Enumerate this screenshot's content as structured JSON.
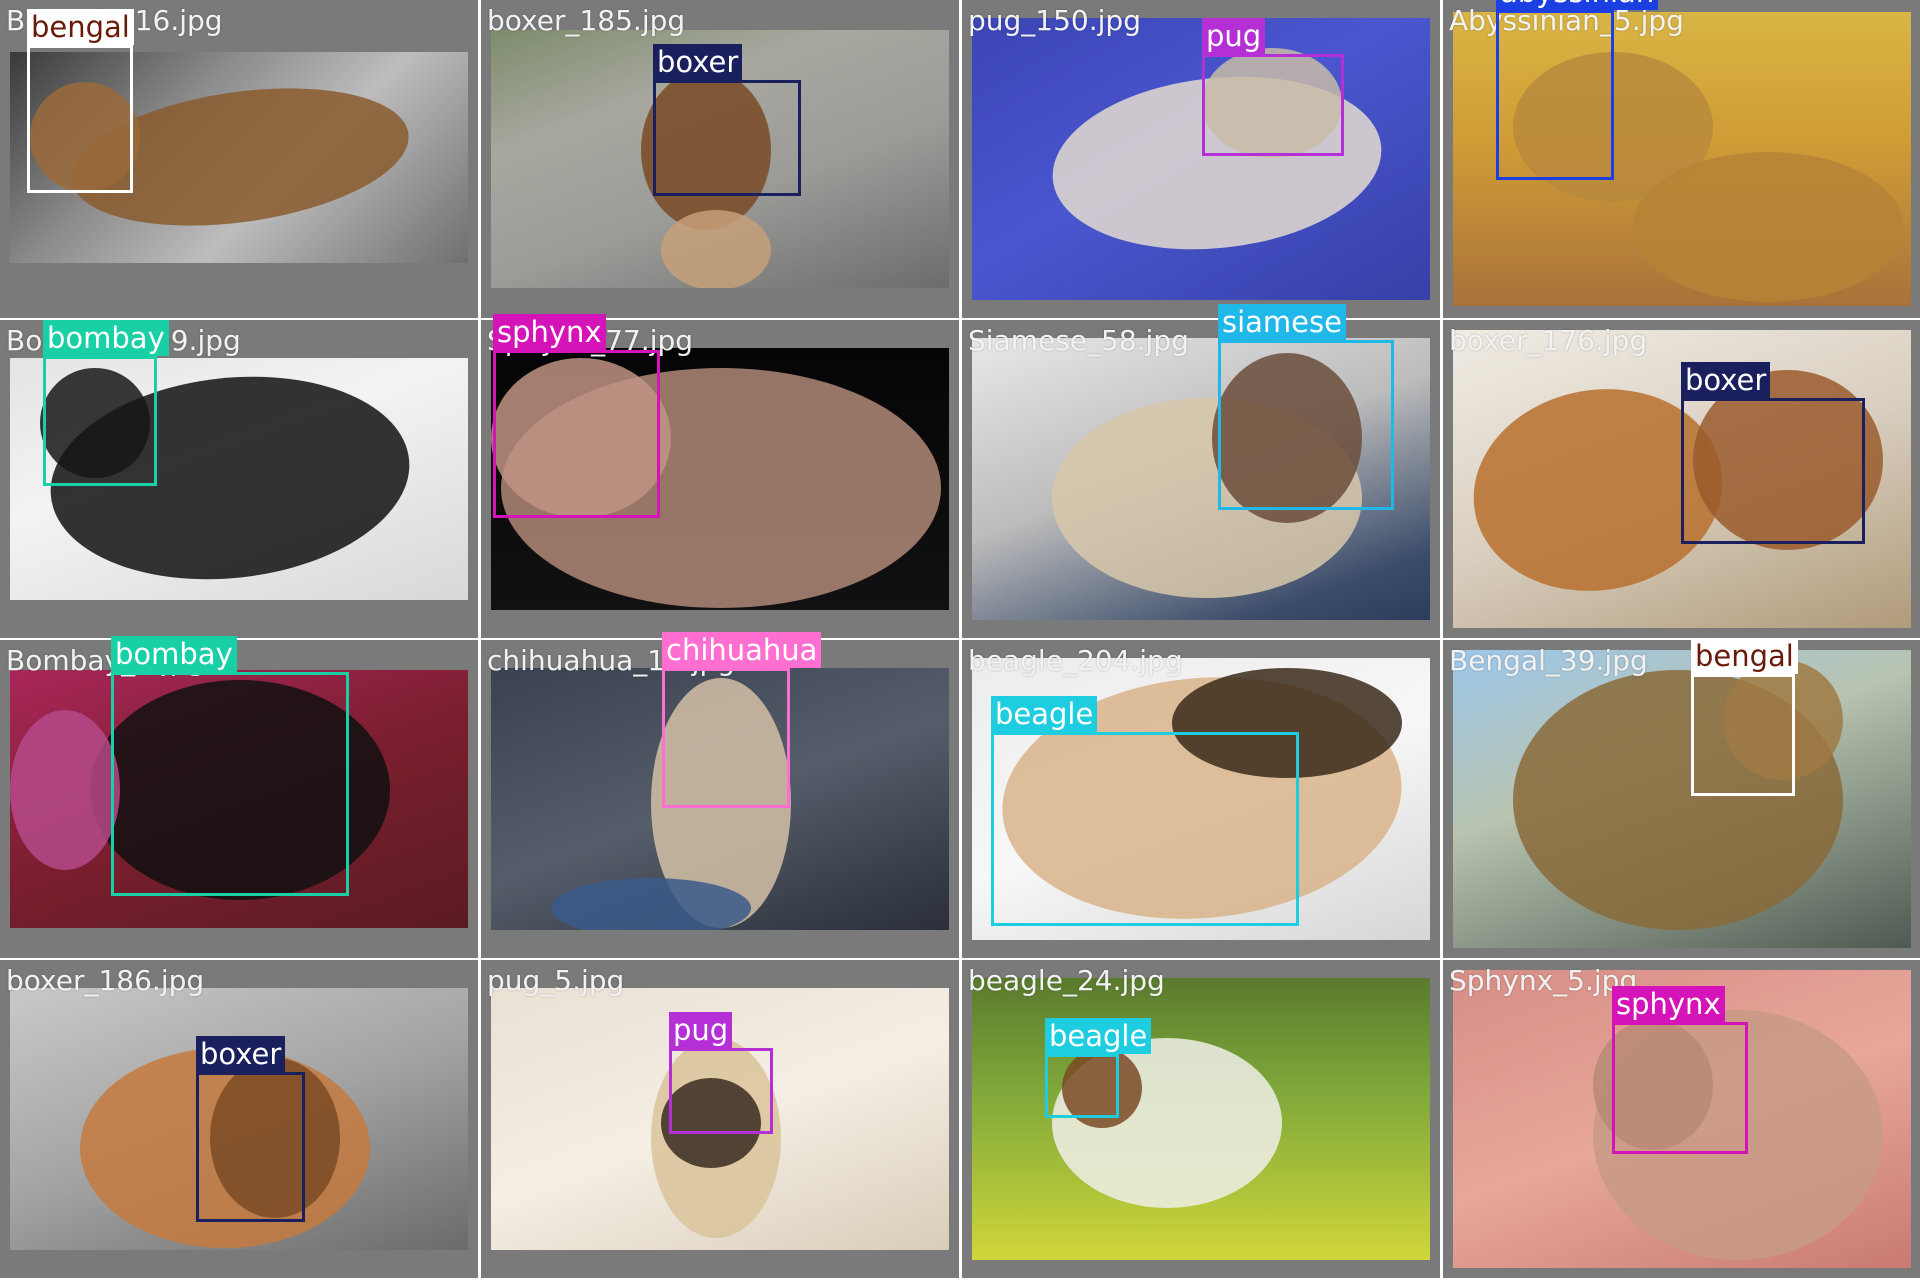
{
  "colors": {
    "bengal": "#ffffff",
    "boxer": "#1a1f5e",
    "pug": "#b52fd6",
    "abyssinian": "#1b3fe0",
    "bombay": "#19cfa6",
    "sphynx": "#d414b8",
    "siamese": "#1fb8e8",
    "chihuahua": "#ff6fd2",
    "beagle": "#1ecde0"
  },
  "tiles": [
    {
      "filename": "Bengal_116.jpg",
      "detections": [
        {
          "label": "bengal"
        }
      ]
    },
    {
      "filename": "boxer_185.jpg",
      "detections": [
        {
          "label": "boxer"
        }
      ]
    },
    {
      "filename": "pug_150.jpg",
      "detections": [
        {
          "label": "pug"
        }
      ]
    },
    {
      "filename": "Abyssinian_5.jpg",
      "detections": [
        {
          "label": "abyssinian"
        }
      ]
    },
    {
      "filename": "Bombay_209.jpg",
      "detections": [
        {
          "label": "bombay"
        }
      ]
    },
    {
      "filename": "Sphynx_77.jpg",
      "detections": [
        {
          "label": "sphynx"
        }
      ]
    },
    {
      "filename": "Siamese_58.jpg",
      "detections": [
        {
          "label": "siamese"
        }
      ]
    },
    {
      "filename": "boxer_176.jpg",
      "detections": [
        {
          "label": "boxer"
        }
      ]
    },
    {
      "filename": "Bombay_...jpg",
      "detections": [
        {
          "label": "bombay"
        }
      ]
    },
    {
      "filename": "chihuahua_1...jpg",
      "detections": [
        {
          "label": "chihuahua"
        }
      ]
    },
    {
      "filename": "beagle_204.jpg",
      "detections": [
        {
          "label": "beagle"
        }
      ]
    },
    {
      "filename": "Bengal_39.jpg",
      "detections": [
        {
          "label": "bengal"
        }
      ]
    },
    {
      "filename": "boxer_186.jpg",
      "detections": [
        {
          "label": "boxer"
        }
      ]
    },
    {
      "filename": "pug_5.jpg",
      "detections": [
        {
          "label": "pug"
        }
      ]
    },
    {
      "filename": "beagle_24.jpg",
      "detections": [
        {
          "label": "beagle"
        }
      ]
    },
    {
      "filename": "Sphynx_5.jpg",
      "detections": [
        {
          "label": "sphynx"
        }
      ]
    }
  ]
}
